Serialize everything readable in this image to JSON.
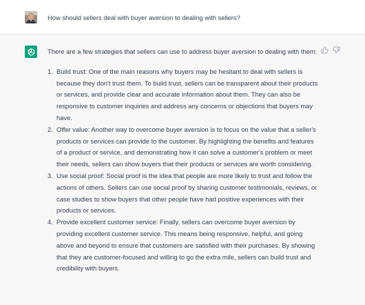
{
  "conversation": {
    "user_message": "How should sellers deal with buyer aversion to dealing with sellers?",
    "assistant_intro": "There are a few strategies that sellers can use to address buyer aversion to dealing with them:",
    "items": [
      {
        "number": "1.",
        "text": "Build trust: One of the main reasons why buyers may be hesitant to deal with sellers is because they don't trust them. To build trust, sellers can be transparent about their products or services, and provide clear and accurate information about them. They can also be responsive to customer inquiries and address any concerns or objections that buyers may have."
      },
      {
        "number": "2.",
        "text": "Offer value: Another way to overcome buyer aversion is to focus on the value that a seller's products or services can provide to the customer. By highlighting the benefits and features of a product or service, and demonstrating how it can solve a customer's problem or meet their needs, sellers can show buyers that their products or services are worth considering."
      },
      {
        "number": "3.",
        "text": "Use social proof: Social proof is the idea that people are more likely to trust and follow the actions of others. Sellers can use social proof by sharing customer testimonials, reviews, or case studies to show buyers that other people have had positive experiences with their products or services."
      },
      {
        "number": "4.",
        "text": "Provide excellent customer service: Finally, sellers can overcome buyer aversion by providing excellent customer service. This means being responsive, helpful, and going above and beyond to ensure that customers are satisfied with their purchases. By showing that they are customer-focused and willing to go the extra mile, sellers can build trust and credibility with buyers."
      }
    ]
  },
  "icons": {
    "user_avatar": "user-avatar-photo",
    "assistant_avatar": "openai-logo-icon",
    "thumbs_up": "thumbs-up-icon",
    "thumbs_down": "thumbs-down-icon"
  },
  "colors": {
    "assistant_bg": "#f7f7f8",
    "brand_green": "#10a37f",
    "text": "#374151"
  }
}
